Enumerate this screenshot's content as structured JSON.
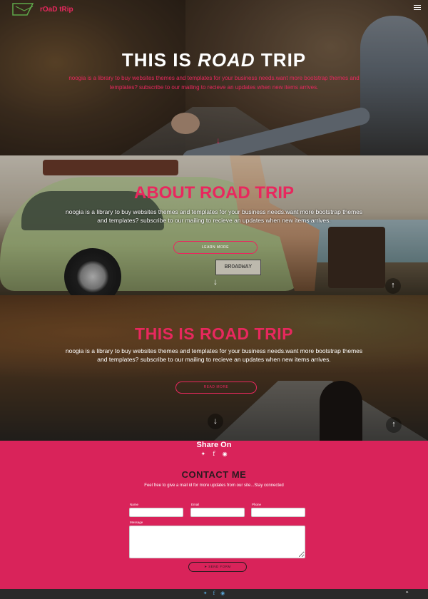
{
  "brand": {
    "name": "rOaD tRip"
  },
  "hero": {
    "title_prefix": "THIS IS",
    "title_emph": "ROAD",
    "title_suffix": "TRIP",
    "text": "noogia is a library to buy websites themes and templates for your business needs.want more bootstrap themes and templates? subscribe to our mailing to recieve an updates when new items arrives."
  },
  "about": {
    "title": "ABOUT ROAD TRIP",
    "text": "noogia is a library to buy websites themes and templates for your business needs.want more bootstrap themes and templates? subscribe to our mailing to recieve an updates when new items arrives.",
    "button": "LEARN MORE",
    "plate": "BROADWAY"
  },
  "trip": {
    "title": "THIS IS ROAD TRIP",
    "text": "noogia is a library to buy websites themes and templates for your business needs.want more bootstrap themes and templates? subscribe to our mailing to recieve an updates when new items arrives.",
    "button": "READ MORE"
  },
  "share": {
    "title": "Share On"
  },
  "contact": {
    "title": "CONTACT ME",
    "subtitle": "Feel free to give a mail id for more updates from our site...Stay connected",
    "fields": {
      "name": "Name",
      "email": "Email",
      "phone": "Phone",
      "message": "Message"
    },
    "button": "SEND FORM"
  },
  "icons": {
    "twitter": "twitter-icon",
    "facebook": "facebook-icon",
    "instagram": "instagram-icon",
    "arrow_down": "arrow-down-icon",
    "arrow_up": "arrow-up-icon",
    "menu": "menu-icon",
    "send": "send-icon"
  },
  "colors": {
    "accent": "#e8285e",
    "contact_bg": "#d9235a",
    "footer_bg": "#2a2a2a",
    "footer_icons": "#5aa7d8"
  }
}
